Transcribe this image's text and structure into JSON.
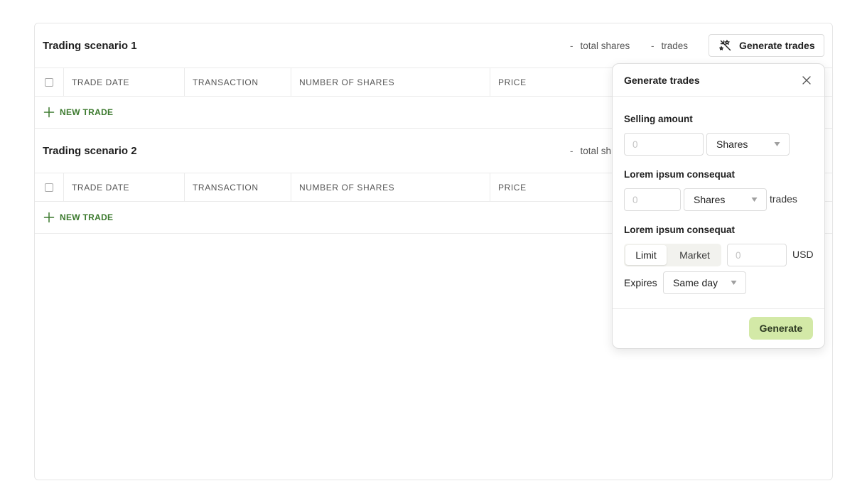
{
  "scenarios": [
    {
      "title": "Trading scenario 1",
      "stat_total_dash": "-",
      "stat_total_label": "total shares",
      "stat_trades_dash": "-",
      "stat_trades_label": "trades",
      "columns": [
        "TRADE DATE",
        "TRANSACTION",
        "NUMBER OF SHARES",
        "PRICE"
      ],
      "new_trade_label": "NEW TRADE"
    },
    {
      "title": "Trading scenario 2",
      "stat_total_dash": "-",
      "stat_total_label": "total sh",
      "columns": [
        "TRADE DATE",
        "TRANSACTION",
        "NUMBER OF SHARES",
        "PRICE"
      ],
      "new_trade_label": "NEW TRADE"
    }
  ],
  "generate_trades_button": {
    "label": "Generate trades",
    "icon": "magic-wand-icon"
  },
  "popover": {
    "title": "Generate trades",
    "close_icon": "close-icon",
    "selling_amount": {
      "label": "Selling amount",
      "value": "",
      "placeholder": "0",
      "unit": "Shares"
    },
    "section2": {
      "label": "Lorem ipsum consequat",
      "value": "",
      "placeholder": "0",
      "unit": "Shares",
      "suffix": "trades"
    },
    "section3": {
      "label": "Lorem ipsum consequat",
      "order_types": [
        "Limit",
        "Market"
      ],
      "selected_order_type": "Limit",
      "value": "",
      "placeholder": "0",
      "currency": "USD",
      "expires_label": "Expires",
      "expires_value": "Same day"
    },
    "generate_label": "Generate"
  },
  "colors": {
    "accent_green": "#3c7a2e",
    "generate_button_bg": "#d3e9a7",
    "border": "#e6e6e6"
  }
}
